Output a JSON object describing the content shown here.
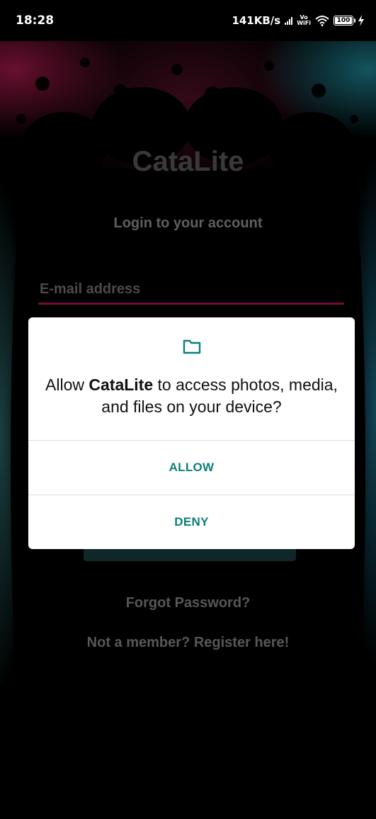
{
  "status_bar": {
    "time": "18:28",
    "network_speed": "141KB/s",
    "vowifi_top": "Vo",
    "vowifi_bottom": "WiFi",
    "battery": "100"
  },
  "login_screen": {
    "app_title": "CataLite",
    "subtitle": "Login to your account",
    "email_placeholder": "E-mail address",
    "forgot_password": "Forgot Password?",
    "register": "Not a member? Register here!"
  },
  "permission_dialog": {
    "icon": "folder-icon",
    "message_prefix": "Allow ",
    "app_name": "CataLite",
    "message_suffix": " to access photos, media, and files on your device?",
    "allow_label": "ALLOW",
    "deny_label": "DENY"
  },
  "colors": {
    "accent_teal": "#0d7f78",
    "underline_magenta": "#b8125e",
    "background": "#000000"
  }
}
